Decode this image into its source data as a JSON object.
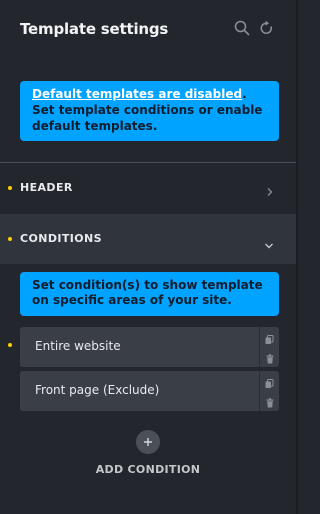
{
  "panel": {
    "title": "Template settings"
  },
  "alert": {
    "link_text": "Default templates are disabled",
    "text": ". Set template conditions or enable default templates."
  },
  "sections": {
    "header_label": "HEADER",
    "conditions_label": "CONDITIONS"
  },
  "conditions": {
    "info": "Set condition(s) to show template on specific areas of your site.",
    "items": [
      {
        "label": "Entire website"
      },
      {
        "label": "Front page (Exclude)"
      }
    ],
    "add_label": "ADD CONDITION"
  },
  "colors": {
    "background": "#23272d",
    "accent": "#00a3ff",
    "indicator": "#ffcc00"
  },
  "icons": {
    "search": "search-icon",
    "reset": "refresh-icon",
    "expand": "chevron-right-icon",
    "collapse": "chevron-down-icon",
    "copy": "copy-icon",
    "delete": "trash-icon",
    "add": "plus-icon"
  }
}
